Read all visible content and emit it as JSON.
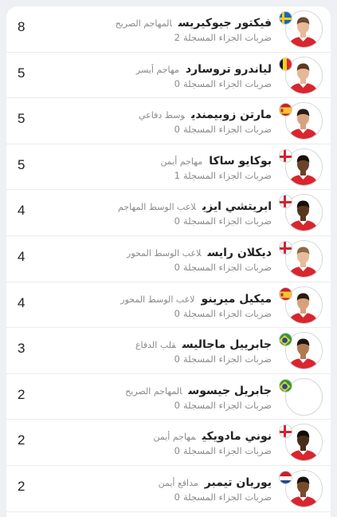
{
  "colors": {
    "background": "#eef0f3",
    "card": "#ffffff",
    "divider": "#ebebeb",
    "muted_text": "#8a8a8a",
    "kit_red": "#d8262f"
  },
  "penalty_label": "ضربات الجزاء المسجلة",
  "players": [
    {
      "name": "فيكتور جيوكيريس",
      "position": "المهاجم الصريح",
      "penalties": "2",
      "score": "8",
      "flag": "sweden-flag-icon",
      "avatar": "kit-photo"
    },
    {
      "name": "لياندرو تروسارد",
      "position": "مهاجم أيسر",
      "penalties": "0",
      "score": "5",
      "flag": "belgium-flag-icon",
      "avatar": "kit-photo"
    },
    {
      "name": "مارتن زوبيمندي",
      "position": "وسط دفاعي",
      "penalties": "0",
      "score": "5",
      "flag": "spain-flag-icon",
      "avatar": "kit-photo"
    },
    {
      "name": "بوكايو ساكا",
      "position": "مهاجم أيمن",
      "penalties": "1",
      "score": "5",
      "flag": "england-flag-icon",
      "avatar": "kit-photo"
    },
    {
      "name": "ابريتشي ايزي",
      "position": "لاعب الوسط المهاجم",
      "penalties": "0",
      "score": "4",
      "flag": "england-flag-icon",
      "avatar": "kit-photo"
    },
    {
      "name": "ديكلان رايس",
      "position": "لاعب الوسط المحور",
      "penalties": "0",
      "score": "4",
      "flag": "england-flag-icon",
      "avatar": "kit-photo"
    },
    {
      "name": "ميكيل ميرينو",
      "position": "لاعب الوسط المحور",
      "penalties": "0",
      "score": "4",
      "flag": "spain-flag-icon",
      "avatar": "kit-photo"
    },
    {
      "name": "جابرييل ماجاليس",
      "position": "قلب الدفاع",
      "penalties": "0",
      "score": "3",
      "flag": "brazil-flag-icon",
      "avatar": "kit-photo"
    },
    {
      "name": "جابريل جيسوس",
      "position": "المهاجم الصريح",
      "penalties": "0",
      "score": "2",
      "flag": "brazil-flag-icon",
      "avatar": "empty"
    },
    {
      "name": "نوني مادويكي",
      "position": "مهاجم أيمن",
      "penalties": "0",
      "score": "2",
      "flag": "england-flag-icon",
      "avatar": "kit-photo"
    },
    {
      "name": "يوريان تيمبر",
      "position": "مدافع أيمن",
      "penalties": "0",
      "score": "2",
      "flag": "netherlands-flag-icon",
      "avatar": "kit-photo"
    }
  ]
}
